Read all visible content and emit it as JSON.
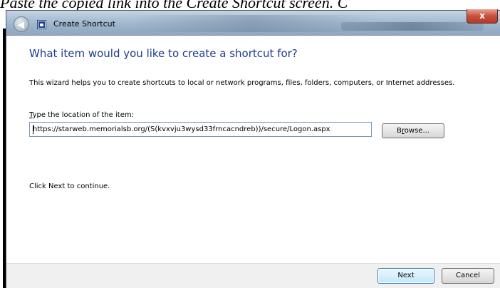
{
  "caption": "Paste the copied link into the Create Shortcut screen. C",
  "window": {
    "title": "Create Shortcut",
    "close_glyph": "x"
  },
  "main": {
    "heading": "What item would you like to create a shortcut for?",
    "description": "This wizard helps you to create shortcuts to local or network programs, files, folders, computers, or Internet addresses.",
    "location_label_prefix": "T",
    "location_label_rest": "ype the location of the item:",
    "location_value": "https://starweb.memorialsb.org/(S(kvxvju3wysd33frncacndreb))/secure/Logon.aspx",
    "browse_label_prefix": "B",
    "browse_label_u": "r",
    "browse_label_rest": "owse...",
    "hint": "Click Next to continue."
  },
  "footer": {
    "next_label": "Next",
    "cancel_label": "Cancel"
  },
  "icons": {
    "back": "back-arrow-icon",
    "app": "shortcut-wizard-icon",
    "close": "close-icon"
  },
  "colors": {
    "heading": "#1e3c8c",
    "close_button": "#c9503c",
    "next_button_border": "#3c7fb1"
  }
}
